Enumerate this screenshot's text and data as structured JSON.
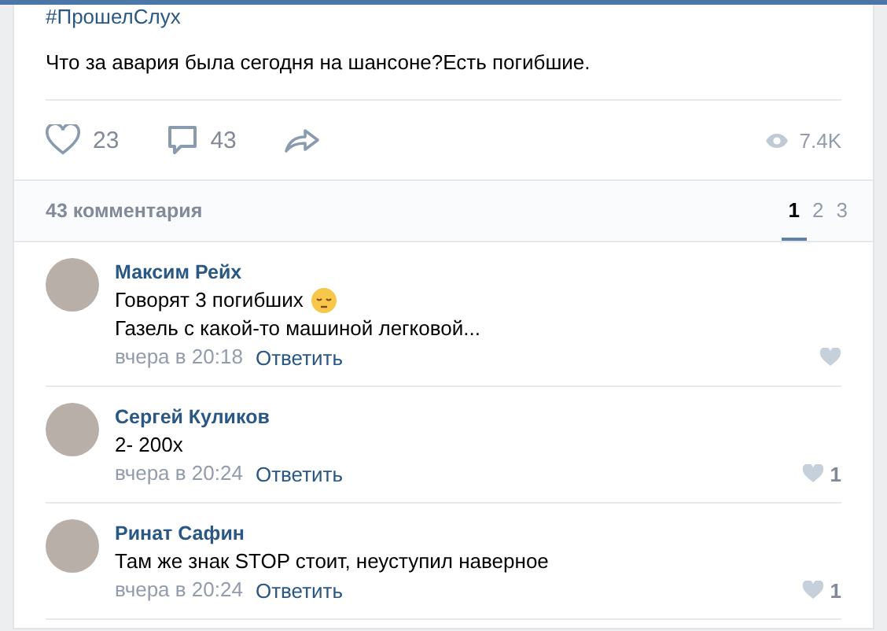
{
  "post": {
    "hashtag": "#ПрошелСлух",
    "text": "Что за авария была сегодня на шансоне?Есть погибшие.",
    "likes": "23",
    "comments": "43",
    "views": "7.4K"
  },
  "comments_header": {
    "count": "43 комментария",
    "pages": [
      {
        "label": "1",
        "selected": true
      },
      {
        "label": "2",
        "selected": false
      },
      {
        "label": "3",
        "selected": false
      }
    ]
  },
  "comments": [
    {
      "author": "Максим Рейх",
      "lines": [
        "Говорят 3 погибших",
        "Газель с какой-то машиной легковой..."
      ],
      "sad_emoji": true,
      "time": "вчера в 20:18",
      "reply": "Ответить"
    },
    {
      "author": "Сергей Куликов",
      "lines": [
        "2- 200х"
      ],
      "sad_emoji": false,
      "time": "вчера в 20:24",
      "reply": "Ответить",
      "likes": "1"
    },
    {
      "author": "Ринат Сафин",
      "lines": [
        "Там же знак STOP стоит, неуступил наверное"
      ],
      "sad_emoji": false,
      "time": "вчера в 20:24",
      "reply": "Ответить",
      "likes": "1"
    }
  ]
}
